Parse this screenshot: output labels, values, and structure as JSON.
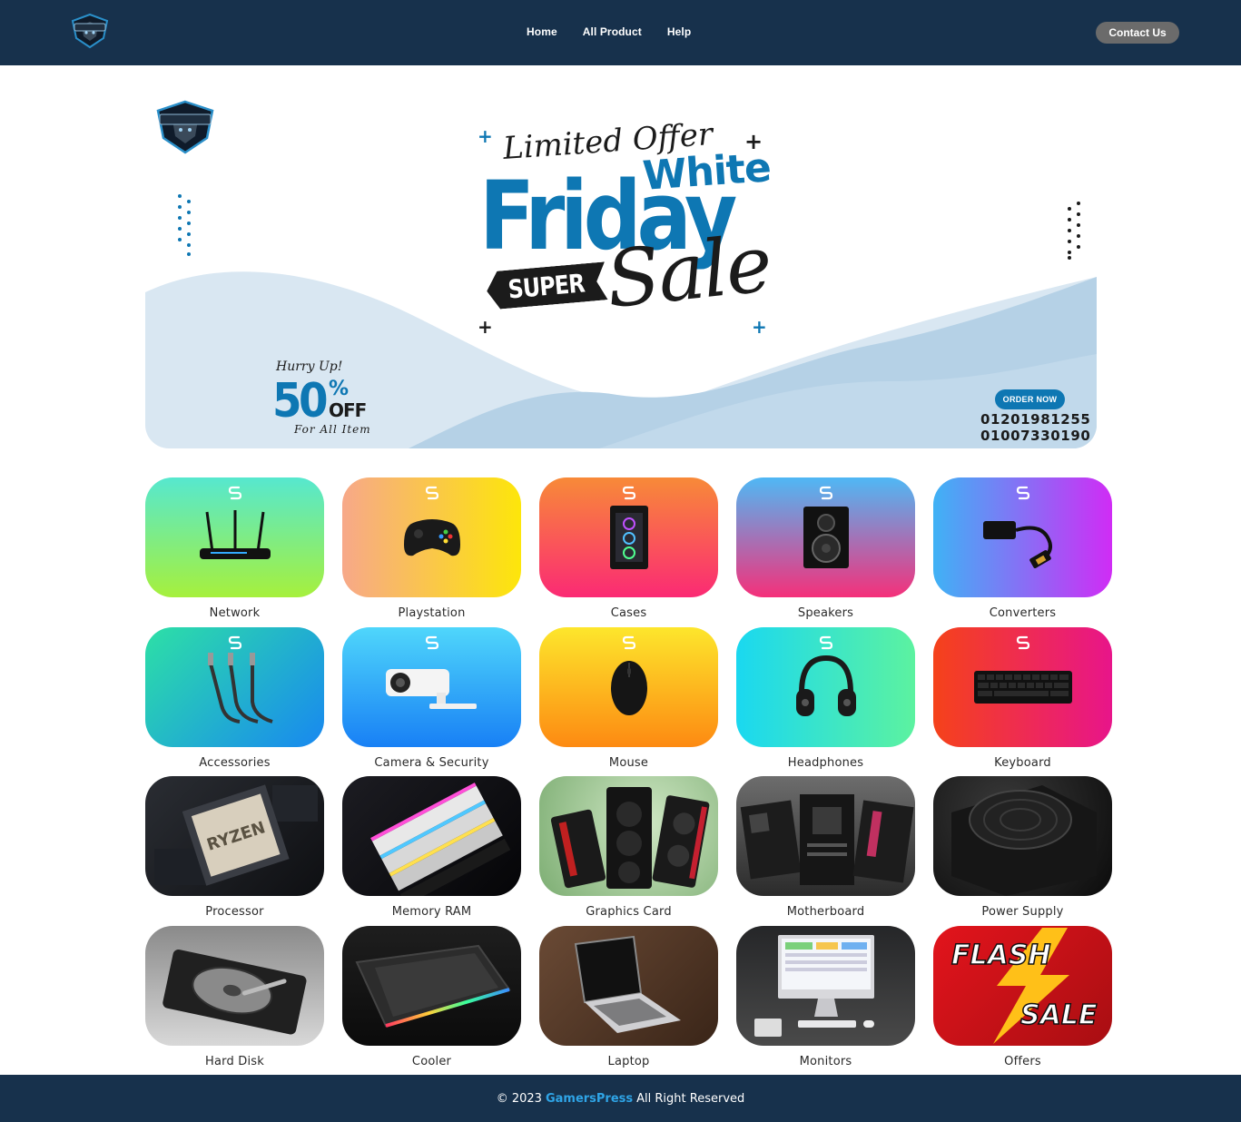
{
  "header": {
    "logo_icon": "gamerspress-shield-logo",
    "nav": [
      {
        "label": "Home"
      },
      {
        "label": "All Product"
      },
      {
        "label": "Help"
      }
    ],
    "contact_label": "Contact Us"
  },
  "banner": {
    "limited": "Limited Offer",
    "white": "White",
    "friday": "Friday",
    "super": "SUPER",
    "sale": "Sale",
    "hurry": "Hurry Up!",
    "discount": "50",
    "percent": "%",
    "off": "OFF",
    "for_all": "For All Item",
    "order_now": "ORDER NOW",
    "phone1": "01201981255",
    "phone2": "01007330190",
    "accent": "#0e77b3"
  },
  "categories": [
    {
      "label": "Network",
      "icon": "router-icon"
    },
    {
      "label": "Playstation",
      "icon": "gamepad-icon"
    },
    {
      "label": "Cases",
      "icon": "pc-case-icon"
    },
    {
      "label": "Speakers",
      "icon": "speaker-icon"
    },
    {
      "label": "Converters",
      "icon": "hdmi-converter-icon"
    },
    {
      "label": "Accessories",
      "icon": "audio-cable-icon"
    },
    {
      "label": "Camera & Security",
      "icon": "security-camera-icon"
    },
    {
      "label": "Mouse",
      "icon": "mouse-icon"
    },
    {
      "label": "Headphones",
      "icon": "headphones-icon"
    },
    {
      "label": "Keyboard",
      "icon": "keyboard-icon"
    },
    {
      "label": "Processor",
      "icon": "cpu-photo"
    },
    {
      "label": "Memory RAM",
      "icon": "ram-photo"
    },
    {
      "label": "Graphics Card",
      "icon": "gpu-photo"
    },
    {
      "label": "Motherboard",
      "icon": "motherboard-photo"
    },
    {
      "label": "Power Supply",
      "icon": "psu-photo"
    },
    {
      "label": "Hard Disk",
      "icon": "hdd-photo"
    },
    {
      "label": "Cooler",
      "icon": "cooling-pad-photo"
    },
    {
      "label": "Laptop",
      "icon": "laptop-photo"
    },
    {
      "label": "Monitors",
      "icon": "monitor-photo"
    },
    {
      "label": "Offers",
      "icon": "flash-sale-banner",
      "flash": "FLASH",
      "sale": "SALE"
    }
  ],
  "footer": {
    "prefix": "© 2023",
    "brand": "GamersPress",
    "suffix": "All Right Reserved"
  }
}
